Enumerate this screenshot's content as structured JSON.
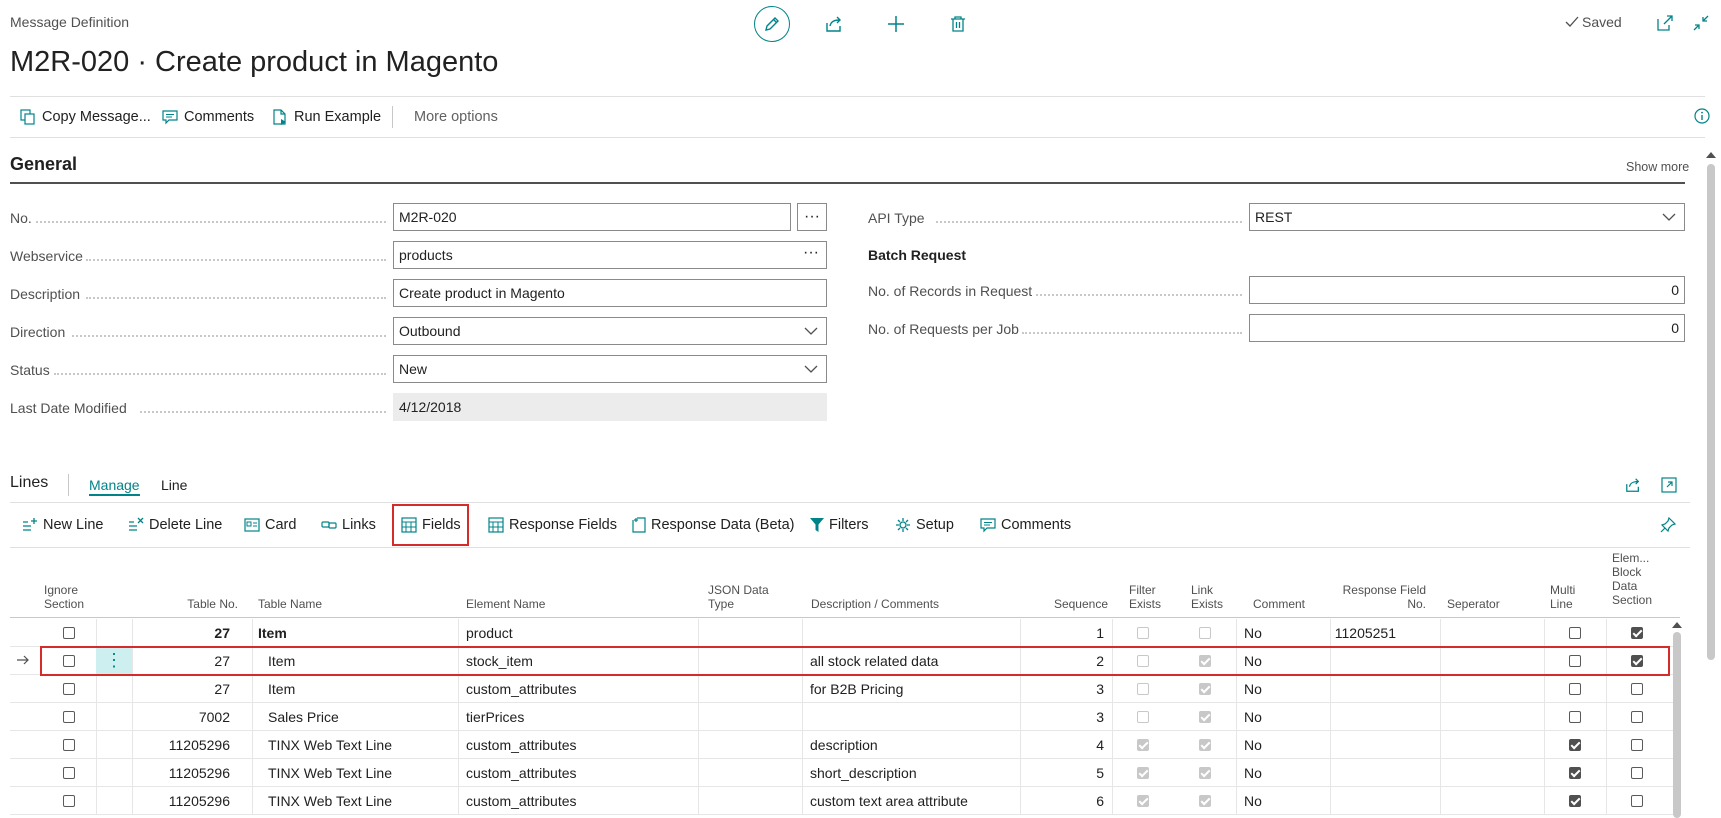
{
  "header": {
    "page_label": "Message Definition",
    "title": "M2R-020 · Create product in Magento",
    "saved_label": "Saved"
  },
  "actions": {
    "copy_message": "Copy Message...",
    "comments": "Comments",
    "run_example": "Run Example",
    "more_options": "More options"
  },
  "general": {
    "title": "General",
    "show_more": "Show more",
    "fields": {
      "no": {
        "label": "No.",
        "value": "M2R-020"
      },
      "webservice": {
        "label": "Webservice",
        "value": "products"
      },
      "description": {
        "label": "Description",
        "value": "Create product in Magento"
      },
      "direction": {
        "label": "Direction",
        "value": "Outbound"
      },
      "status": {
        "label": "Status",
        "value": "New"
      },
      "last_date_modified": {
        "label": "Last Date Modified",
        "value": "4/12/2018"
      },
      "api_type": {
        "label": "API Type",
        "value": "REST"
      },
      "batch_request": {
        "label": "Batch Request"
      },
      "records_in_request": {
        "label": "No. of Records in Request",
        "value": "0"
      },
      "requests_per_job": {
        "label": "No. of Requests per Job",
        "value": "0"
      }
    }
  },
  "lines": {
    "title": "Lines",
    "tabs": [
      "Manage",
      "Line"
    ],
    "toolbar": {
      "new_line": "New Line",
      "delete_line": "Delete Line",
      "card": "Card",
      "links": "Links",
      "fields": "Fields",
      "response_fields": "Response Fields",
      "response_data": "Response Data (Beta)",
      "filters": "Filters",
      "setup": "Setup",
      "comments": "Comments"
    },
    "columns": {
      "ignore_section": [
        "Ignore",
        "Section"
      ],
      "table_no": "Table No.",
      "table_name": "Table Name",
      "element_name": "Element Name",
      "json_data_type": [
        "JSON Data",
        "Type"
      ],
      "description": "Description / Comments",
      "sequence": "Sequence",
      "filter_exists": [
        "Filter",
        "Exists"
      ],
      "link_exists": [
        "Link",
        "Exists"
      ],
      "comment": "Comment",
      "response_field_no": [
        "Response Field",
        "No."
      ],
      "seperator": "Seperator",
      "multi_line": [
        "Multi",
        "Line"
      ],
      "element_block": [
        "Elem...",
        "Block",
        "Data",
        "Section"
      ]
    },
    "rows": [
      {
        "table_no": "27",
        "table_name": "Item",
        "element": "product",
        "description": "",
        "sequence": "1",
        "comment": "No",
        "response_field_no": "11205251",
        "bold": true,
        "filter": "off",
        "link": "off",
        "multi": false,
        "block": true
      },
      {
        "table_no": "27",
        "table_name": "Item",
        "element": "stock_item",
        "description": "all stock related data",
        "sequence": "2",
        "comment": "No",
        "response_field_no": "",
        "bold": false,
        "filter": "off",
        "link": "on",
        "multi": false,
        "block": true
      },
      {
        "table_no": "27",
        "table_name": "Item",
        "element": "custom_attributes",
        "description": "for B2B Pricing",
        "sequence": "3",
        "comment": "No",
        "response_field_no": "",
        "bold": false,
        "filter": "off",
        "link": "on",
        "multi": false,
        "block": false
      },
      {
        "table_no": "7002",
        "table_name": "Sales Price",
        "element": "tierPrices",
        "description": "",
        "sequence": "3",
        "comment": "No",
        "response_field_no": "",
        "bold": false,
        "filter": "off",
        "link": "on",
        "multi": false,
        "block": false
      },
      {
        "table_no": "11205296",
        "table_name": "TINX Web Text Line",
        "element": "custom_attributes",
        "description": "description",
        "sequence": "4",
        "comment": "No",
        "response_field_no": "",
        "bold": false,
        "filter": "on",
        "link": "on",
        "multi": true,
        "block": false
      },
      {
        "table_no": "11205296",
        "table_name": "TINX Web Text Line",
        "element": "custom_attributes",
        "description": "short_description",
        "sequence": "5",
        "comment": "No",
        "response_field_no": "",
        "bold": false,
        "filter": "on",
        "link": "on",
        "multi": true,
        "block": false
      },
      {
        "table_no": "11205296",
        "table_name": "TINX Web Text Line",
        "element": "custom_attributes",
        "description": "custom text area attribute",
        "sequence": "6",
        "comment": "No",
        "response_field_no": "",
        "bold": false,
        "filter": "on",
        "link": "on",
        "multi": true,
        "block": false
      }
    ]
  },
  "colors": {
    "accent": "#008489",
    "highlight": "#d52b2b",
    "selected_cell": "#cdeff0"
  }
}
